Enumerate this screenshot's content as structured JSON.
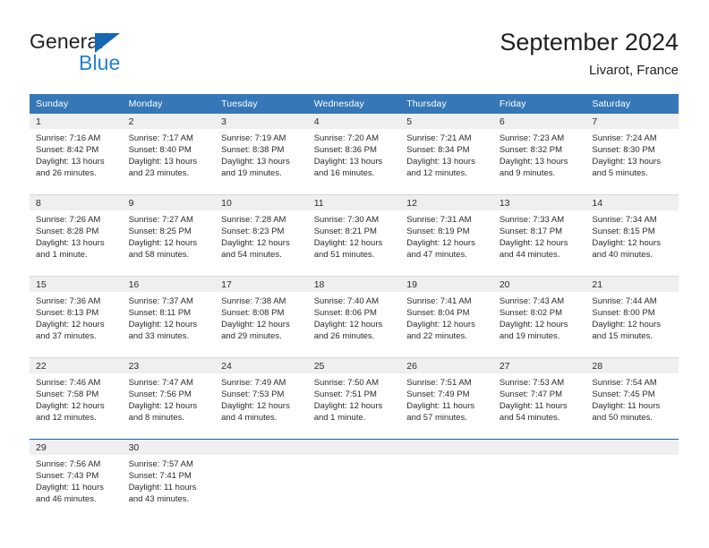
{
  "brand": {
    "name_part1": "General",
    "name_part2": "Blue",
    "logo_icon": "triangle-logo-icon"
  },
  "header": {
    "title": "September 2024",
    "subtitle": "Livarot, France"
  },
  "calendar": {
    "weekday_headers": [
      "Sunday",
      "Monday",
      "Tuesday",
      "Wednesday",
      "Thursday",
      "Friday",
      "Saturday"
    ],
    "colors": {
      "header_background": "#3577b7",
      "daynumber_strip": "#efefef",
      "cell_background": "#ffffff",
      "grid_line": "#d9d9d9",
      "accent_blue": "#1a63a5",
      "brand_blue": "#2081d0",
      "text": "#2b2b2b"
    },
    "weeks": [
      [
        {
          "day": "1",
          "sunrise": "Sunrise: 7:16 AM",
          "sunset": "Sunset: 8:42 PM",
          "daylight_line1": "Daylight: 13 hours",
          "daylight_line2": "and 26 minutes."
        },
        {
          "day": "2",
          "sunrise": "Sunrise: 7:17 AM",
          "sunset": "Sunset: 8:40 PM",
          "daylight_line1": "Daylight: 13 hours",
          "daylight_line2": "and 23 minutes."
        },
        {
          "day": "3",
          "sunrise": "Sunrise: 7:19 AM",
          "sunset": "Sunset: 8:38 PM",
          "daylight_line1": "Daylight: 13 hours",
          "daylight_line2": "and 19 minutes."
        },
        {
          "day": "4",
          "sunrise": "Sunrise: 7:20 AM",
          "sunset": "Sunset: 8:36 PM",
          "daylight_line1": "Daylight: 13 hours",
          "daylight_line2": "and 16 minutes."
        },
        {
          "day": "5",
          "sunrise": "Sunrise: 7:21 AM",
          "sunset": "Sunset: 8:34 PM",
          "daylight_line1": "Daylight: 13 hours",
          "daylight_line2": "and 12 minutes."
        },
        {
          "day": "6",
          "sunrise": "Sunrise: 7:23 AM",
          "sunset": "Sunset: 8:32 PM",
          "daylight_line1": "Daylight: 13 hours",
          "daylight_line2": "and 9 minutes."
        },
        {
          "day": "7",
          "sunrise": "Sunrise: 7:24 AM",
          "sunset": "Sunset: 8:30 PM",
          "daylight_line1": "Daylight: 13 hours",
          "daylight_line2": "and 5 minutes."
        }
      ],
      [
        {
          "day": "8",
          "sunrise": "Sunrise: 7:26 AM",
          "sunset": "Sunset: 8:28 PM",
          "daylight_line1": "Daylight: 13 hours",
          "daylight_line2": "and 1 minute."
        },
        {
          "day": "9",
          "sunrise": "Sunrise: 7:27 AM",
          "sunset": "Sunset: 8:25 PM",
          "daylight_line1": "Daylight: 12 hours",
          "daylight_line2": "and 58 minutes."
        },
        {
          "day": "10",
          "sunrise": "Sunrise: 7:28 AM",
          "sunset": "Sunset: 8:23 PM",
          "daylight_line1": "Daylight: 12 hours",
          "daylight_line2": "and 54 minutes."
        },
        {
          "day": "11",
          "sunrise": "Sunrise: 7:30 AM",
          "sunset": "Sunset: 8:21 PM",
          "daylight_line1": "Daylight: 12 hours",
          "daylight_line2": "and 51 minutes."
        },
        {
          "day": "12",
          "sunrise": "Sunrise: 7:31 AM",
          "sunset": "Sunset: 8:19 PM",
          "daylight_line1": "Daylight: 12 hours",
          "daylight_line2": "and 47 minutes."
        },
        {
          "day": "13",
          "sunrise": "Sunrise: 7:33 AM",
          "sunset": "Sunset: 8:17 PM",
          "daylight_line1": "Daylight: 12 hours",
          "daylight_line2": "and 44 minutes."
        },
        {
          "day": "14",
          "sunrise": "Sunrise: 7:34 AM",
          "sunset": "Sunset: 8:15 PM",
          "daylight_line1": "Daylight: 12 hours",
          "daylight_line2": "and 40 minutes."
        }
      ],
      [
        {
          "day": "15",
          "sunrise": "Sunrise: 7:36 AM",
          "sunset": "Sunset: 8:13 PM",
          "daylight_line1": "Daylight: 12 hours",
          "daylight_line2": "and 37 minutes."
        },
        {
          "day": "16",
          "sunrise": "Sunrise: 7:37 AM",
          "sunset": "Sunset: 8:11 PM",
          "daylight_line1": "Daylight: 12 hours",
          "daylight_line2": "and 33 minutes."
        },
        {
          "day": "17",
          "sunrise": "Sunrise: 7:38 AM",
          "sunset": "Sunset: 8:08 PM",
          "daylight_line1": "Daylight: 12 hours",
          "daylight_line2": "and 29 minutes."
        },
        {
          "day": "18",
          "sunrise": "Sunrise: 7:40 AM",
          "sunset": "Sunset: 8:06 PM",
          "daylight_line1": "Daylight: 12 hours",
          "daylight_line2": "and 26 minutes."
        },
        {
          "day": "19",
          "sunrise": "Sunrise: 7:41 AM",
          "sunset": "Sunset: 8:04 PM",
          "daylight_line1": "Daylight: 12 hours",
          "daylight_line2": "and 22 minutes."
        },
        {
          "day": "20",
          "sunrise": "Sunrise: 7:43 AM",
          "sunset": "Sunset: 8:02 PM",
          "daylight_line1": "Daylight: 12 hours",
          "daylight_line2": "and 19 minutes."
        },
        {
          "day": "21",
          "sunrise": "Sunrise: 7:44 AM",
          "sunset": "Sunset: 8:00 PM",
          "daylight_line1": "Daylight: 12 hours",
          "daylight_line2": "and 15 minutes."
        }
      ],
      [
        {
          "day": "22",
          "sunrise": "Sunrise: 7:46 AM",
          "sunset": "Sunset: 7:58 PM",
          "daylight_line1": "Daylight: 12 hours",
          "daylight_line2": "and 12 minutes."
        },
        {
          "day": "23",
          "sunrise": "Sunrise: 7:47 AM",
          "sunset": "Sunset: 7:56 PM",
          "daylight_line1": "Daylight: 12 hours",
          "daylight_line2": "and 8 minutes."
        },
        {
          "day": "24",
          "sunrise": "Sunrise: 7:49 AM",
          "sunset": "Sunset: 7:53 PM",
          "daylight_line1": "Daylight: 12 hours",
          "daylight_line2": "and 4 minutes."
        },
        {
          "day": "25",
          "sunrise": "Sunrise: 7:50 AM",
          "sunset": "Sunset: 7:51 PM",
          "daylight_line1": "Daylight: 12 hours",
          "daylight_line2": "and 1 minute."
        },
        {
          "day": "26",
          "sunrise": "Sunrise: 7:51 AM",
          "sunset": "Sunset: 7:49 PM",
          "daylight_line1": "Daylight: 11 hours",
          "daylight_line2": "and 57 minutes."
        },
        {
          "day": "27",
          "sunrise": "Sunrise: 7:53 AM",
          "sunset": "Sunset: 7:47 PM",
          "daylight_line1": "Daylight: 11 hours",
          "daylight_line2": "and 54 minutes."
        },
        {
          "day": "28",
          "sunrise": "Sunrise: 7:54 AM",
          "sunset": "Sunset: 7:45 PM",
          "daylight_line1": "Daylight: 11 hours",
          "daylight_line2": "and 50 minutes."
        }
      ],
      [
        {
          "day": "29",
          "sunrise": "Sunrise: 7:56 AM",
          "sunset": "Sunset: 7:43 PM",
          "daylight_line1": "Daylight: 11 hours",
          "daylight_line2": "and 46 minutes."
        },
        {
          "day": "30",
          "sunrise": "Sunrise: 7:57 AM",
          "sunset": "Sunset: 7:41 PM",
          "daylight_line1": "Daylight: 11 hours",
          "daylight_line2": "and 43 minutes."
        },
        {
          "day": "",
          "sunrise": "",
          "sunset": "",
          "daylight_line1": "",
          "daylight_line2": ""
        },
        {
          "day": "",
          "sunrise": "",
          "sunset": "",
          "daylight_line1": "",
          "daylight_line2": ""
        },
        {
          "day": "",
          "sunrise": "",
          "sunset": "",
          "daylight_line1": "",
          "daylight_line2": ""
        },
        {
          "day": "",
          "sunrise": "",
          "sunset": "",
          "daylight_line1": "",
          "daylight_line2": ""
        },
        {
          "day": "",
          "sunrise": "",
          "sunset": "",
          "daylight_line1": "",
          "daylight_line2": ""
        }
      ]
    ]
  }
}
